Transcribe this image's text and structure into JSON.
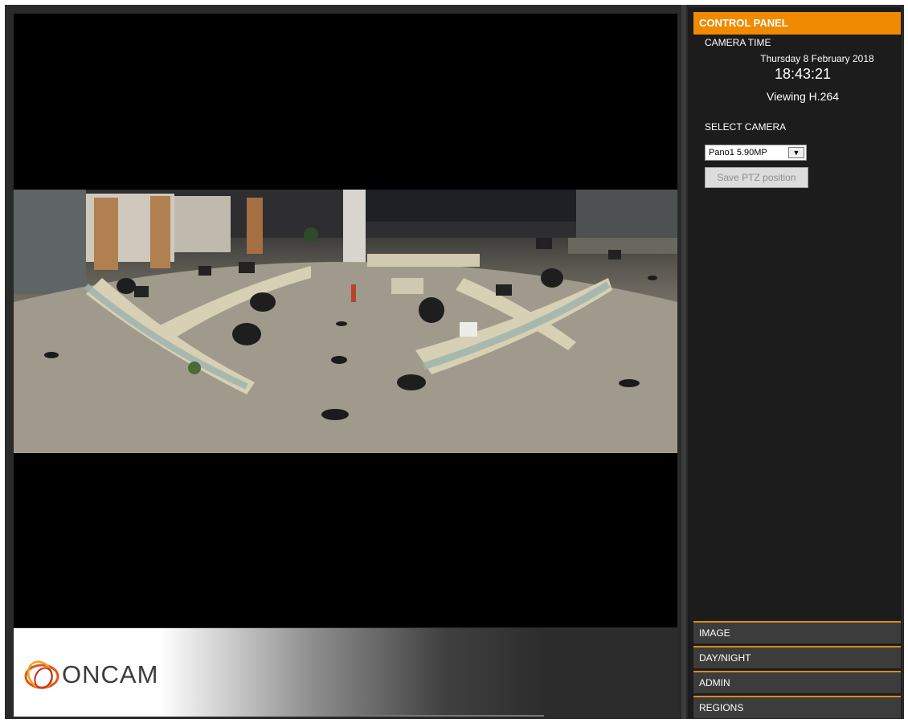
{
  "logo": {
    "brand": "ONCAM"
  },
  "panel": {
    "header": "CONTROL PANEL",
    "camera_time_label": "CAMERA TIME",
    "date": "Thursday 8 February 2018",
    "time": "18:43:21",
    "viewing": "Viewing H.264",
    "select_camera_label": "SELECT CAMERA",
    "camera_selected": "Pano1 5.90MP",
    "save_ptz_label": "Save PTZ position",
    "sections": {
      "image": "IMAGE",
      "day_night": "DAY/NIGHT",
      "admin": "ADMIN",
      "regions": "REGIONS"
    }
  },
  "colors": {
    "accent": "#f08a00",
    "panel_bg": "#1c1c1c",
    "section_bg": "#3c3c3c"
  }
}
